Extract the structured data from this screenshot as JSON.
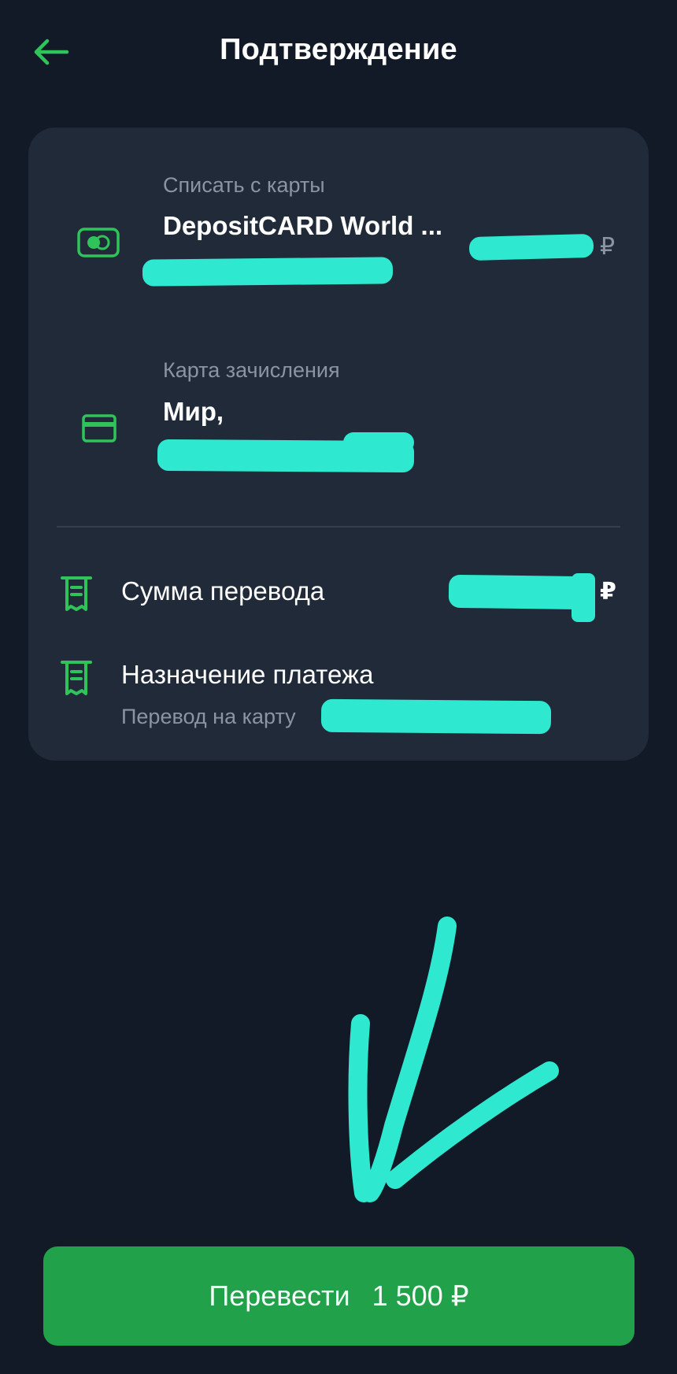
{
  "header": {
    "back_icon": "arrow-left-icon",
    "title": "Подтверждение"
  },
  "colors": {
    "background": "#121a27",
    "card": "#202a38",
    "accent_green": "#21a24a",
    "icon_green": "#2fc45a",
    "muted_text": "#8a94a3",
    "redaction_marker": "#2ee8d0"
  },
  "debit_card": {
    "icon": "debit-card-toggle-icon",
    "label": "Списать с карты",
    "card_name": "DepositCARD World ...",
    "currency": "₽"
  },
  "credit_card": {
    "icon": "credit-card-icon",
    "label": "Карта зачисления",
    "card_name": "Мир,"
  },
  "transfer_amount": {
    "icon": "receipt-icon",
    "label": "Сумма перевода",
    "currency": "₽"
  },
  "payment_purpose": {
    "icon": "receipt-icon",
    "label": "Назначение платежа",
    "value": "Перевод на карту"
  },
  "submit": {
    "label": "Перевести",
    "amount": "1 500 ₽"
  },
  "annotation": {
    "icon": "hand-drawn-arrow-down-icon"
  }
}
